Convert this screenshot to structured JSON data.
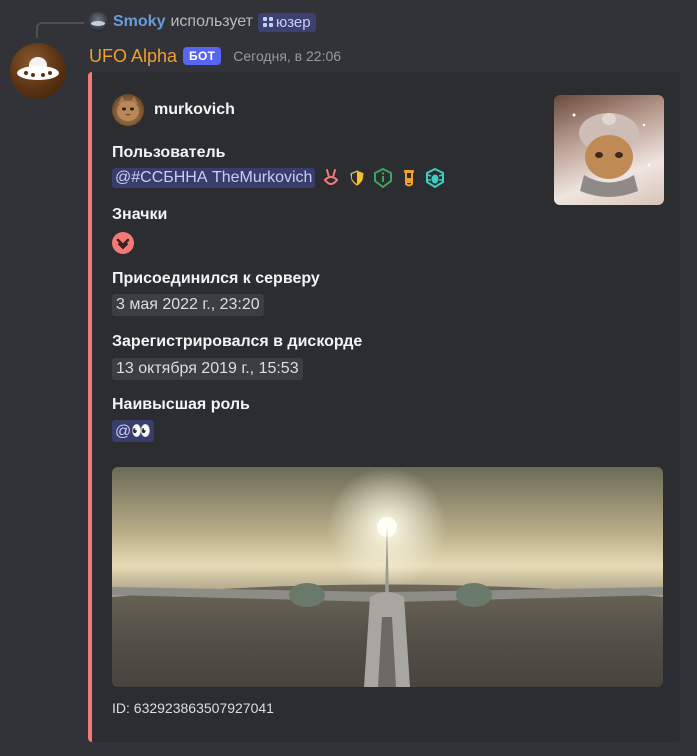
{
  "reply": {
    "user": "Smoky",
    "action": "использует",
    "command": "юзер"
  },
  "message": {
    "author": "UFO Alpha",
    "bot_tag": "БОТ",
    "timestamp": "Сегодня, в 22:06"
  },
  "embed": {
    "accent_color": "#f47a7a",
    "author_name": "murkovich",
    "fields": {
      "user_label": "Пользователь",
      "user_mention": "@#ССБННА TheMurkovich",
      "badges_label": "Значки",
      "joined_label": "Присоединился к серверу",
      "joined_value": "3 мая 2022 г., 23:20",
      "registered_label": "Зарегистрировался в дискорде",
      "registered_value": "13 октября 2019 г., 15:53",
      "role_label": "Наивысшая роль",
      "role_value": "@👀"
    },
    "badge_icons": [
      "bunny-badge-icon",
      "shield-badge-icon",
      "info-badge-icon",
      "tube-badge-icon",
      "bug-hunter-badge-icon",
      "chevron-badge-icon"
    ],
    "footer": "ID: 632923863507927041"
  },
  "colors": {
    "background": "#313338",
    "embed_bg": "#2b2d31",
    "bot_tag": "#5865f2",
    "author_name": "#f0a030"
  }
}
